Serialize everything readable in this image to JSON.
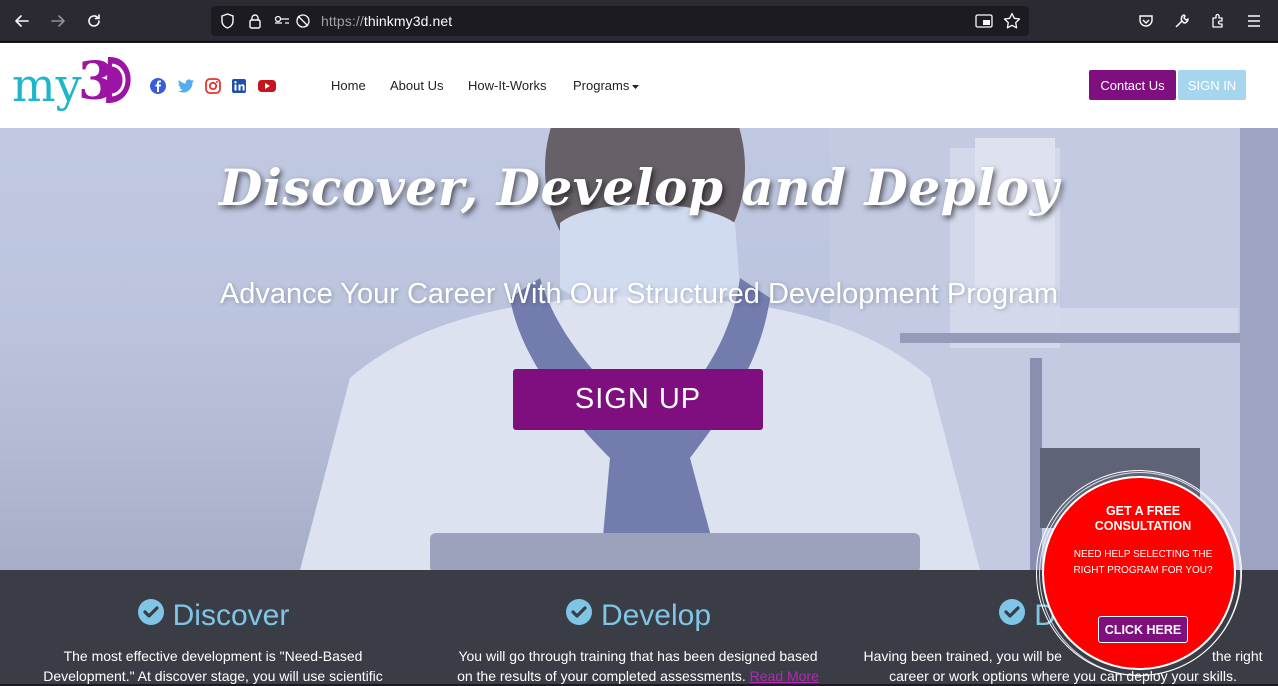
{
  "browser": {
    "url_protocol": "https://",
    "url_host": "thinkmy3d.net",
    "icons": [
      "back-icon",
      "forward-icon",
      "reload-icon",
      "shield-icon",
      "lock-icon",
      "permissions-icon",
      "tracking-off-icon",
      "picture-in-picture-icon",
      "bookmark-star-icon",
      "pocket-icon",
      "wrench-icon",
      "extensions-icon",
      "menu-icon"
    ]
  },
  "header": {
    "logo_text": "my3D",
    "social": [
      "facebook-icon",
      "twitter-icon",
      "instagram-icon",
      "linkedin-icon",
      "youtube-icon"
    ],
    "nav": {
      "home": "Home",
      "about": "About Us",
      "how": "How-It-Works",
      "programs": "Programs"
    },
    "contact_label": "Contact Us",
    "signin_label": "SIGN IN"
  },
  "hero": {
    "title": "Discover, Develop and Deploy",
    "subtitle": "Advance Your Career With Our Structured Development Program",
    "cta_label": "SIGN UP"
  },
  "features": [
    {
      "title": "Discover",
      "line1": "The most effective development is \"Need-Based",
      "line2": "Development.\" At discover stage, you will use scientific"
    },
    {
      "title": "Develop",
      "line1": "You will go through training that has been designed based",
      "line2": "on the results of your completed assessments.",
      "link": "Read More"
    },
    {
      "title": "Deploy",
      "line1": "Having been trained, you will be",
      "line1b": "the right",
      "line2": "career or work options where you can deploy your skills."
    }
  ],
  "consultation": {
    "heading": "GET A FREE CONSULTATION",
    "text": "NEED HELP SELECTING THE RIGHT PROGRAM FOR YOU?",
    "cta": "CLICK HERE"
  },
  "colors": {
    "brand_purple": "#7f0f7f",
    "signin_blue": "#a6d6ee",
    "feature_blue": "#7fc6e6",
    "badge_red": "#ff0000"
  }
}
